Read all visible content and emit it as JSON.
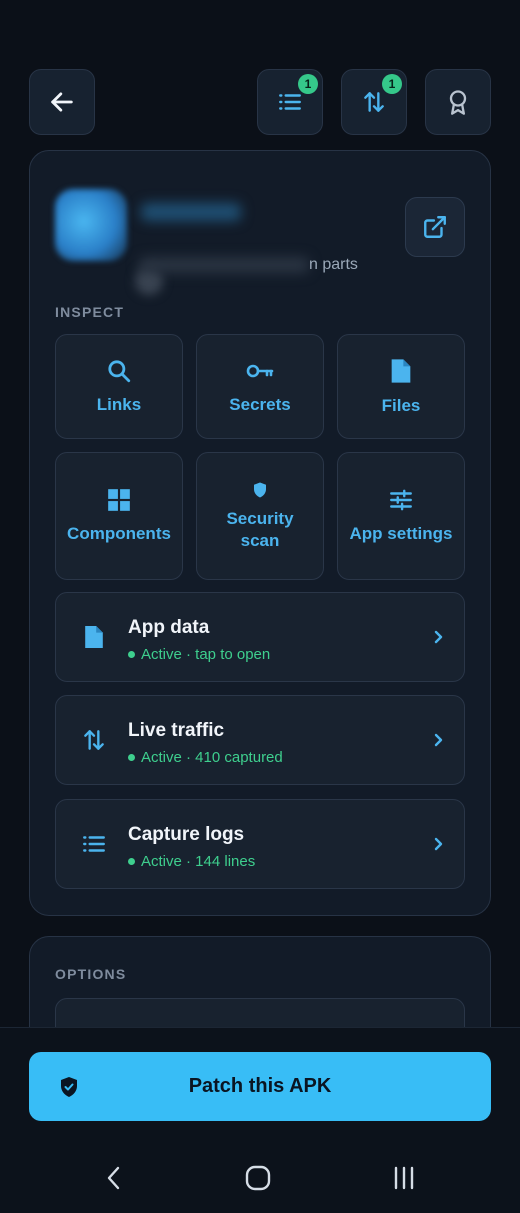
{
  "colors": {
    "background": "#0b1018",
    "card": "#121b28",
    "accent": "#38bdf6",
    "tile_text": "#4bb4ee",
    "active_green": "#3ecf8e",
    "badge_green": "#35c88a"
  },
  "topbar": {
    "back_icon": "arrow-left-icon",
    "logs_icon": "list-icon",
    "logs_badge": "1",
    "traffic_icon": "swap-vertical-icon",
    "traffic_badge": "1",
    "award_icon": "award-ribbon-icon"
  },
  "app_header": {
    "subtitle_fragment": "n parts",
    "open_icon": "external-link-icon"
  },
  "inspect": {
    "label": "INSPECT",
    "tiles": [
      {
        "label": "Links",
        "icon": "search-icon"
      },
      {
        "label": "Secrets",
        "icon": "key-icon"
      },
      {
        "label": "Files",
        "icon": "file-icon"
      },
      {
        "label": "Components",
        "icon": "grid-icon"
      },
      {
        "label": "Security scan",
        "icon": "shield-icon"
      },
      {
        "label": "App settings",
        "icon": "sliders-icon"
      }
    ],
    "rows": [
      {
        "title": "App data",
        "status": "Active · tap to open",
        "icon": "file-icon"
      },
      {
        "title": "Live traffic",
        "status": "Active · 410 captured",
        "icon": "swap-vertical-icon"
      },
      {
        "title": "Capture logs",
        "status": "Active · 144 lines",
        "icon": "list-icon"
      }
    ]
  },
  "options": {
    "label": "OPTIONS"
  },
  "patch": {
    "label": "Patch this APK",
    "icon": "shield-check-icon"
  },
  "navbar": {
    "back_icon": "nav-back-icon",
    "home_icon": "nav-home-icon",
    "recents_icon": "nav-recents-icon"
  }
}
